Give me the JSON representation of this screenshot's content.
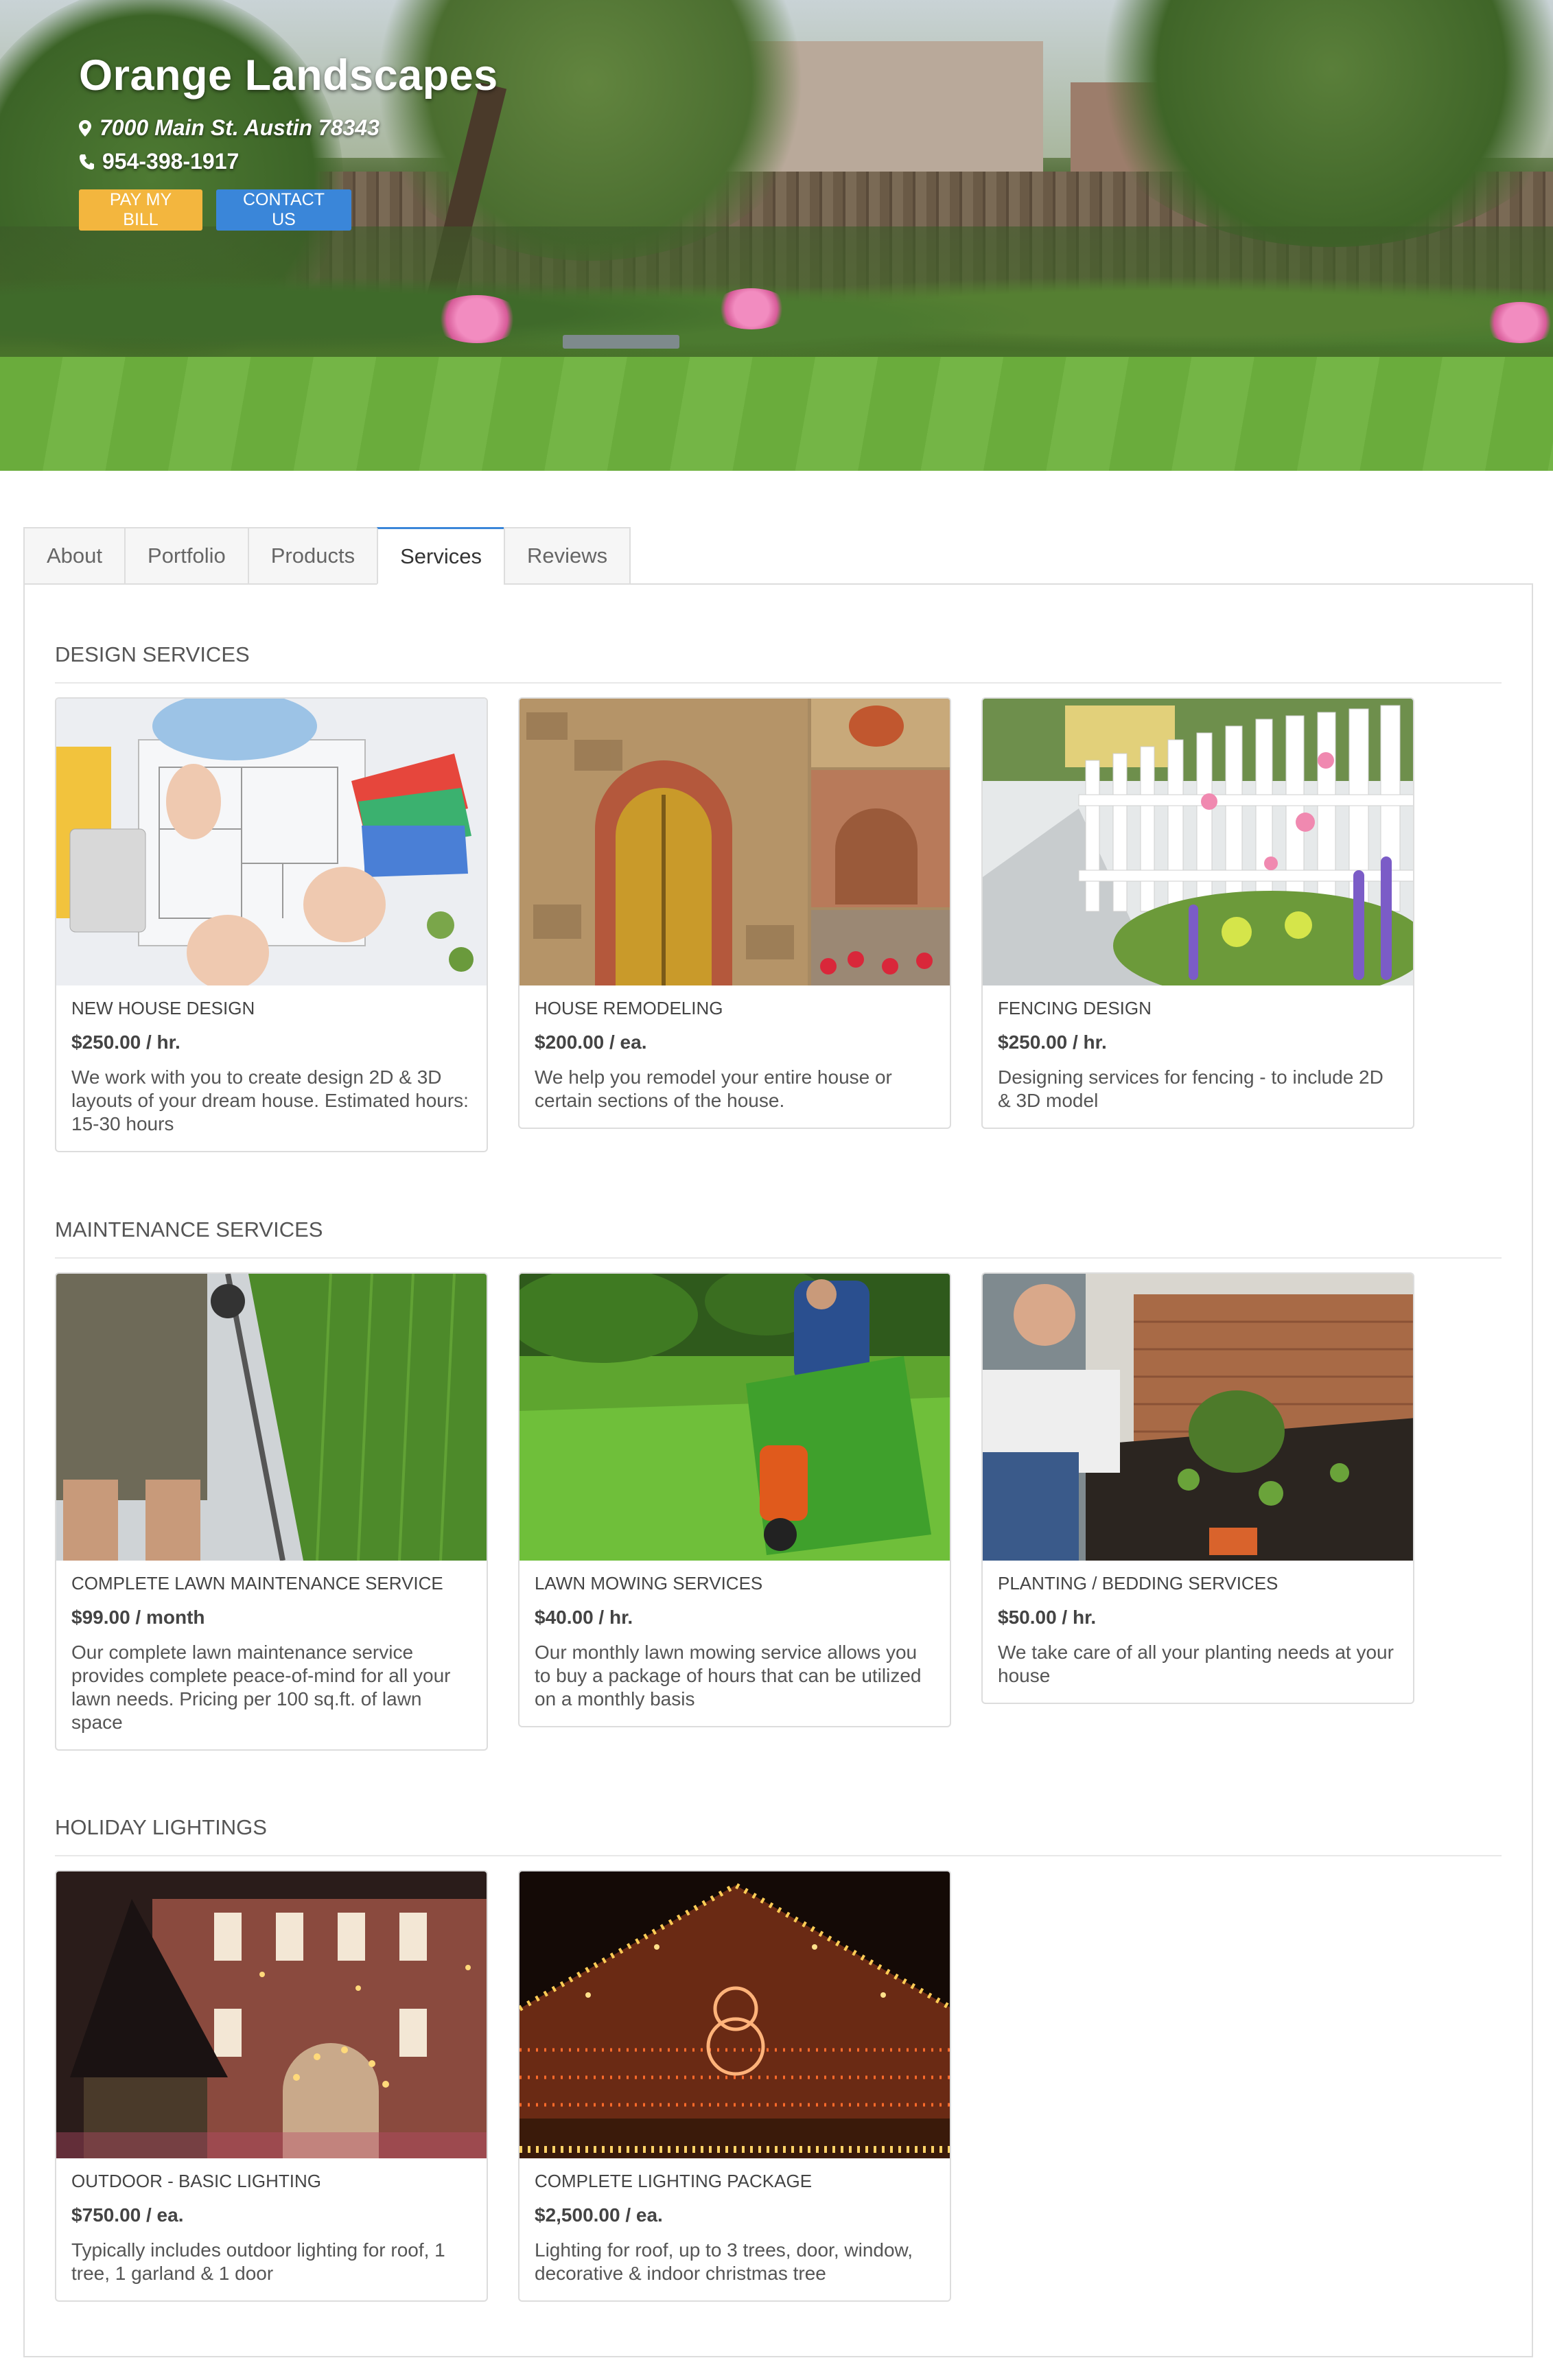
{
  "business": {
    "name": "Orange Landscapes",
    "address": "7000 Main St. Austin 78343",
    "phone": "954-398-1917",
    "pay_button": "PAY MY BILL",
    "contact_button": "CONTACT US"
  },
  "tabs": [
    {
      "label": "About",
      "active": false
    },
    {
      "label": "Portfolio",
      "active": false
    },
    {
      "label": "Products",
      "active": false
    },
    {
      "label": "Services",
      "active": true
    },
    {
      "label": "Reviews",
      "active": false
    }
  ],
  "sections": [
    {
      "title": "DESIGN SERVICES",
      "items": [
        {
          "name": "NEW HOUSE DESIGN",
          "price": "$250.00 / hr.",
          "description": "We work with you to create design 2D & 3D layouts of your dream house. Estimated hours: 15-30 hours"
        },
        {
          "name": "HOUSE REMODELING",
          "price": "$200.00 / ea.",
          "description": "We help you remodel your entire house or certain sections of the house."
        },
        {
          "name": "FENCING DESIGN",
          "price": "$250.00 / hr.",
          "description": "Designing services for fencing - to include 2D & 3D model"
        }
      ]
    },
    {
      "title": "MAINTENANCE SERVICES",
      "items": [
        {
          "name": "COMPLETE LAWN MAINTENANCE SERVICE",
          "price": "$99.00 / month",
          "description": "Our complete lawn maintenance service provides complete peace-of-mind for all your lawn needs. Pricing per 100 sq.ft. of lawn space"
        },
        {
          "name": "LAWN MOWING SERVICES",
          "price": "$40.00 / hr.",
          "description": "Our monthly lawn mowing service allows you to buy a package of hours that can be utilized on a monthly basis"
        },
        {
          "name": "PLANTING / BEDDING SERVICES",
          "price": "$50.00 / hr.",
          "description": "We take care of all your planting needs at your house"
        }
      ]
    },
    {
      "title": "HOLIDAY LIGHTINGS",
      "items": [
        {
          "name": "OUTDOOR - BASIC LIGHTING",
          "price": "$750.00 / ea.",
          "description": "Typically includes outdoor lighting for roof, 1 tree, 1 garland & 1 door"
        },
        {
          "name": "COMPLETE LIGHTING PACKAGE",
          "price": "$2,500.00 / ea.",
          "description": "Lighting for roof, up to 3 trees, door, window, decorative & indoor christmas tree"
        }
      ]
    }
  ],
  "colors": {
    "pay_button": "#f3b63e",
    "contact_button": "#3a86d9",
    "active_tab_accent": "#3a86d9"
  }
}
